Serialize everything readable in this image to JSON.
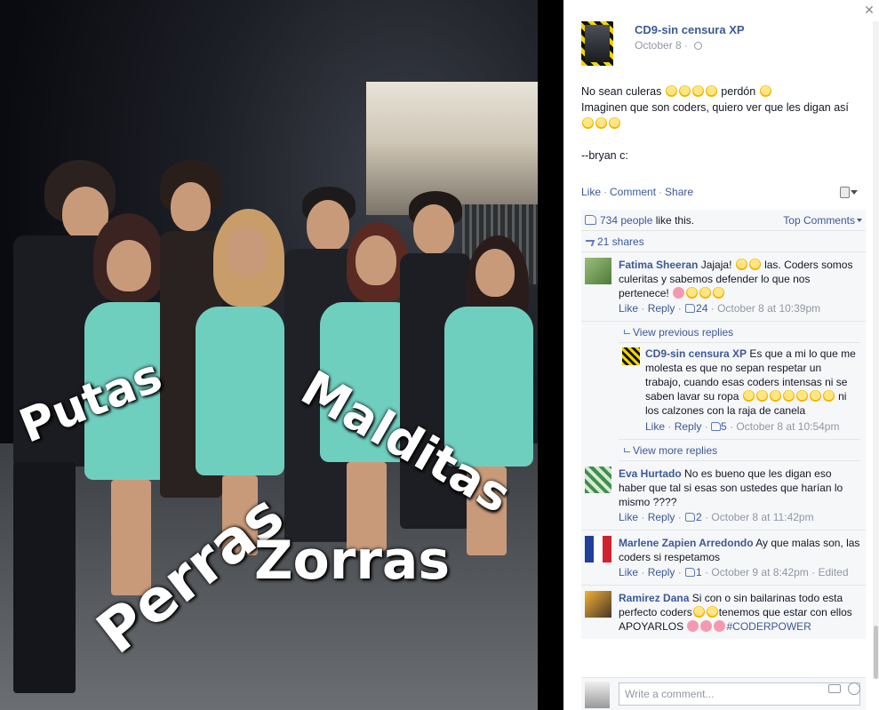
{
  "photo": {
    "overlay_words": [
      "Putas",
      "Perras",
      "Malditas",
      "Zorras"
    ]
  },
  "post": {
    "page_name": "CD9-sin censura XP",
    "date": "October 8",
    "line1_pre": "No sean culeras ",
    "line1_post": " perdón ",
    "line2": "Imaginen que son coders, quiero ver que les digan así",
    "signature": "--bryan c:",
    "actions": {
      "like": "Like",
      "comment": "Comment",
      "share": "Share"
    }
  },
  "ufi": {
    "likes_count": "734 people",
    "likes_suffix": " like this.",
    "top_comments": "Top Comments",
    "shares": "21 shares"
  },
  "comments": [
    {
      "author": "Fatima Sheeran",
      "text_pre": "Jajaja! ",
      "text_mid": " las. Coders somos culeritas y sabemos defender lo que nos pertenece! ",
      "like": "Like",
      "reply": "Reply",
      "likes": "24",
      "time": "October 8 at 10:39pm"
    },
    {
      "author": "Eva Hurtado",
      "text": "No es bueno que les digan eso haber que tal si esas son ustedes que harían lo mismo ????",
      "like": "Like",
      "reply": "Reply",
      "likes": "2",
      "time": "October 8 at 11:42pm"
    },
    {
      "author": "Marlene Zapien Arredondo",
      "text": "Ay que malas son, las coders si respetamos",
      "like": "Like",
      "reply": "Reply",
      "likes": "1",
      "time": "October 9 at 8:42pm",
      "edited": "Edited"
    },
    {
      "author": "Ramirez Dana",
      "text_pre": "Si con o sin bailarinas todo esta perfecto coders",
      "text_mid": "tenemos que estar con ellos APOYARLOS ",
      "hashtag": "#CODERPOWER"
    }
  ],
  "replies": {
    "view_previous": "View previous replies",
    "view_more": "View more replies",
    "reply": {
      "author": "CD9-sin censura XP",
      "text_pre": "Es que a mi lo que me molesta es que no sepan respetar un trabajo, cuando esas coders intensas ni se saben lavar su ropa ",
      "text_post": " ni los calzones con la raja de canela",
      "like": "Like",
      "reply": "Reply",
      "likes": "5",
      "time": "October 8 at 10:54pm"
    }
  },
  "composer": {
    "placeholder": "Write a comment..."
  },
  "colors": {
    "link": "#3b5998",
    "meta": "#9197a3",
    "dress": "#6fcfbf"
  }
}
